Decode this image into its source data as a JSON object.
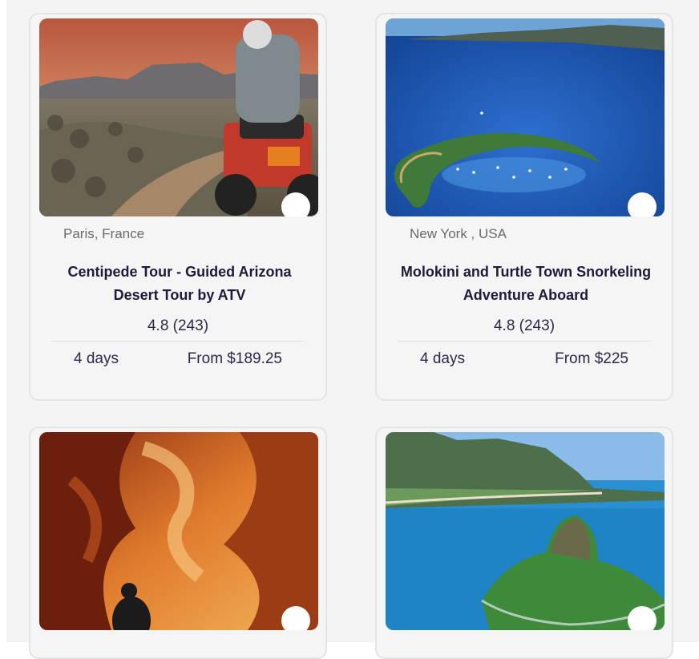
{
  "cards": [
    {
      "location": "Paris, France",
      "title": "Centipede Tour - Guided Arizona Desert Tour by ATV",
      "rating": "4.8 (243)",
      "duration": "4 days",
      "price": "From $189.25",
      "image": "atv-desert-photo"
    },
    {
      "location": "New York , USA",
      "title": "Molokini and Turtle Town Snorkeling Adventure Aboard",
      "rating": "4.8 (243)",
      "duration": "4 days",
      "price": "From $225",
      "image": "molokini-crater-photo"
    },
    {
      "image": "antelope-canyon-photo"
    },
    {
      "image": "island-coast-photo"
    }
  ]
}
